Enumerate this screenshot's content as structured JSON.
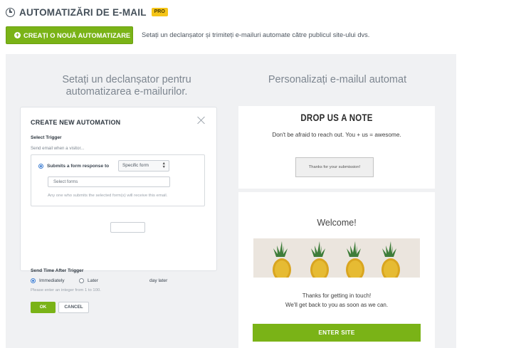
{
  "header": {
    "title": "AUTOMATIZĂRI DE E-MAIL",
    "badge": "PRO"
  },
  "toolbar": {
    "create_label": "CREAȚI O NOUĂ AUTOMATIZARE",
    "description": "Setați un declanșator și trimiteți e-mailuri automate către publicul site-ului dvs."
  },
  "left": {
    "heading_line1": "Setați un declanșator pentru",
    "heading_line2": "automatizarea e-mailurilor."
  },
  "right": {
    "heading": "Personalizați e-mailul automat"
  },
  "dialog": {
    "title": "CREATE NEW AUTOMATION",
    "select_trigger_label": "Select Trigger",
    "send_when": "Send email when a visitor...",
    "trigger_option": "Submits a form response to",
    "trigger_select_value": "Specific form",
    "forms_placeholder": "Select forms",
    "trigger_hint": "Any one who submits the selected form(s) will receive this email.",
    "send_time_label": "Send Time After Trigger",
    "immediately_label": "Immediately",
    "later_label": "Later",
    "day_later_label": "day later",
    "integer_hint": "Please enter an integer from 1 to 100.",
    "ok_label": "OK",
    "cancel_label": "CANCEL"
  },
  "email_preview1": {
    "title": "DROP US A NOTE",
    "subtitle": "Don't be afraid to reach out. You + us = awesome.",
    "button_label": "Thanks for your submission!"
  },
  "email_preview2": {
    "heading": "Welcome!",
    "line1": "Thanks for getting in touch!",
    "line2": "We'll get back to you as soon as we can.",
    "button_label": "ENTER SITE"
  },
  "colors": {
    "accent_green": "#7ab317",
    "pro_badge": "#f5c518",
    "radio_blue": "#3f7fd2"
  }
}
